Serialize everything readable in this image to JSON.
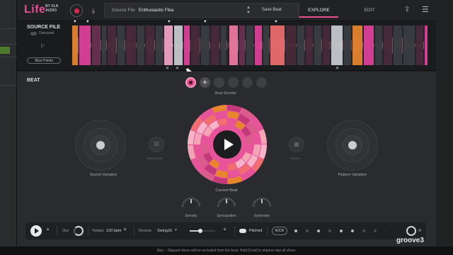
{
  "app": {
    "logo": "Life",
    "brand_line1": "BY XLN",
    "brand_line2": "AUDIO"
  },
  "topbar": {
    "source_label": "Source File",
    "source_value": "Enthusiastic Fika",
    "save_beat": "Save Beat",
    "tab_explore": "EXPLORE",
    "tab_edit": "EDIT"
  },
  "source": {
    "title": "SOURCE FILE",
    "denoised": "Denoised",
    "slice_points": "Slice Points"
  },
  "beat": {
    "title": "BEAT",
    "shortlist_label": "Beat Shortlist",
    "sound_variation": "Sound Variation",
    "pattern_variation": "Pattern Variation",
    "randomize": "Randomize",
    "boxes": "Boxes",
    "current_beat": "Current Beat",
    "density": "Density",
    "syncopation": "Syncopation",
    "symmetry": "Symmetry"
  },
  "transport": {
    "out": "Out",
    "tempo_label": "Tempo",
    "tempo_value": "120 bpm",
    "groove_label": "Groove",
    "groove_value": "Swing16",
    "pitched": "Pitched",
    "kick": "KICK",
    "m_label": "M"
  },
  "status": "Skip – Skipped slices will be excluded from the beat. Hold [Cmd] to skip/un-skip all slices.",
  "watermark": "groove3",
  "colors": {
    "accent": "#ea4e92",
    "orange": "#e8862e",
    "salmon": "#f06e6e",
    "pale_pink": "#f3a5b5"
  }
}
